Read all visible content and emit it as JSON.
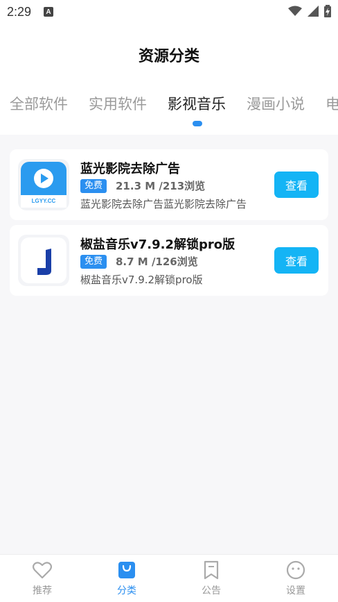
{
  "status_bar": {
    "time": "2:29",
    "indicator": "A"
  },
  "header": {
    "title": "资源分类"
  },
  "tabs": [
    {
      "label": "全部软件"
    },
    {
      "label": "实用软件"
    },
    {
      "label": "影视音乐"
    },
    {
      "label": "漫画小说"
    },
    {
      "label": "电"
    }
  ],
  "active_tab": "影视音乐",
  "accent_color": "#2b8ff0",
  "button_color": "#14b4f5",
  "items": [
    {
      "title": "蓝光影院去除广告",
      "badge": "免费",
      "meta": "21.3 M /213浏览",
      "description": "蓝光影院去除广告蓝光影院去除广告",
      "button": "查看",
      "icon_caption": "LGYY.CC",
      "icon": "play-app-icon"
    },
    {
      "title": "椒盐音乐v7.9.2解锁pro版",
      "badge": "免费",
      "meta": "8.7 M /126浏览",
      "description": "椒盐音乐v7.9.2解锁pro版",
      "button": "查看",
      "icon": "j-letter-app-icon"
    }
  ],
  "bottom_nav": [
    {
      "label": "推荐",
      "icon": "heart-icon"
    },
    {
      "label": "分类",
      "icon": "bag-icon"
    },
    {
      "label": "公告",
      "icon": "bookmark-icon"
    },
    {
      "label": "设置",
      "icon": "smiley-icon"
    }
  ],
  "active_nav": "分类"
}
